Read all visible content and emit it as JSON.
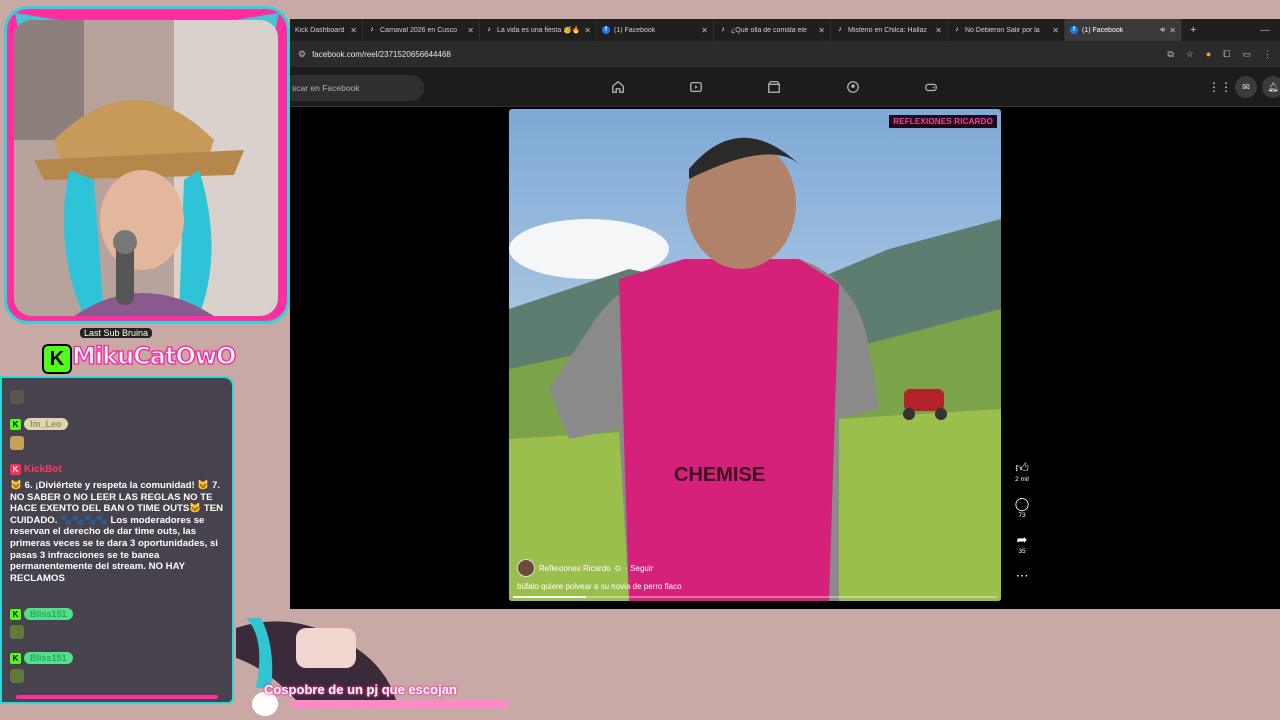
{
  "browser": {
    "tabs": [
      {
        "title": "Kick Dashboard",
        "icon": "kick-icon",
        "active": false
      },
      {
        "title": "Carnaval 2026 en Cusco",
        "icon": "tiktok-icon",
        "active": false
      },
      {
        "title": "La vida es una fiesta 🥳🔥",
        "icon": "tiktok-icon",
        "active": false
      },
      {
        "title": "(1) Facebook",
        "icon": "facebook-icon",
        "active": false
      },
      {
        "title": "¿Qué olla de comida ele",
        "icon": "tiktok-icon",
        "active": false
      },
      {
        "title": "Misterio en Chilca: Hallaz",
        "icon": "tiktok-icon",
        "active": false
      },
      {
        "title": "No Debieron Salir por la",
        "icon": "tiktok-icon",
        "active": false
      },
      {
        "title": "(1) Facebook",
        "icon": "facebook-icon",
        "active": true
      }
    ],
    "url": "facebook.com/reel/2371520656644468"
  },
  "facebook": {
    "search_placeholder": "scar en Facebook",
    "reel": {
      "watermark": "REFLEXIONES RICARDO",
      "author": "Reflexiones Ricardo",
      "follow_label": "· Seguir",
      "caption": "búfalo quiere polvear a su novia de perro flaco",
      "progress": 0.15
    },
    "actions": {
      "likes": "2 mil",
      "comments": "73",
      "shares": "35"
    }
  },
  "stream": {
    "channel_logo": "MikuCatOwO",
    "last_sub_label": "Last Sub Bruina",
    "chat": {
      "users": [
        "Im_Leo",
        "KickBot",
        "Bliss151",
        "Bliss151"
      ],
      "rules_message": "🐱 6. ¡Diviértete y respeta la comunidad! 🐱 7. NO SABER O NO LEER LAS REGLAS NO TE HACE EXENTO DEL BAN O TIME OUTS🐱 TEN CUIDADO. 🐾🐾🐾🐾 Los moderadores se reservan el derecho de dar time outs, las primeras veces se te dara 3 oportunidades, si pasas 3 infracciones se te banea permanentemente del stream. NO HAY RECLAMOS"
    },
    "bottom_banner": "Cospobre de un pj que escojan"
  },
  "colors": {
    "accent_pink": "#ff2fa0",
    "accent_cyan": "#2fd6d8",
    "kick_green": "#53fc18"
  }
}
